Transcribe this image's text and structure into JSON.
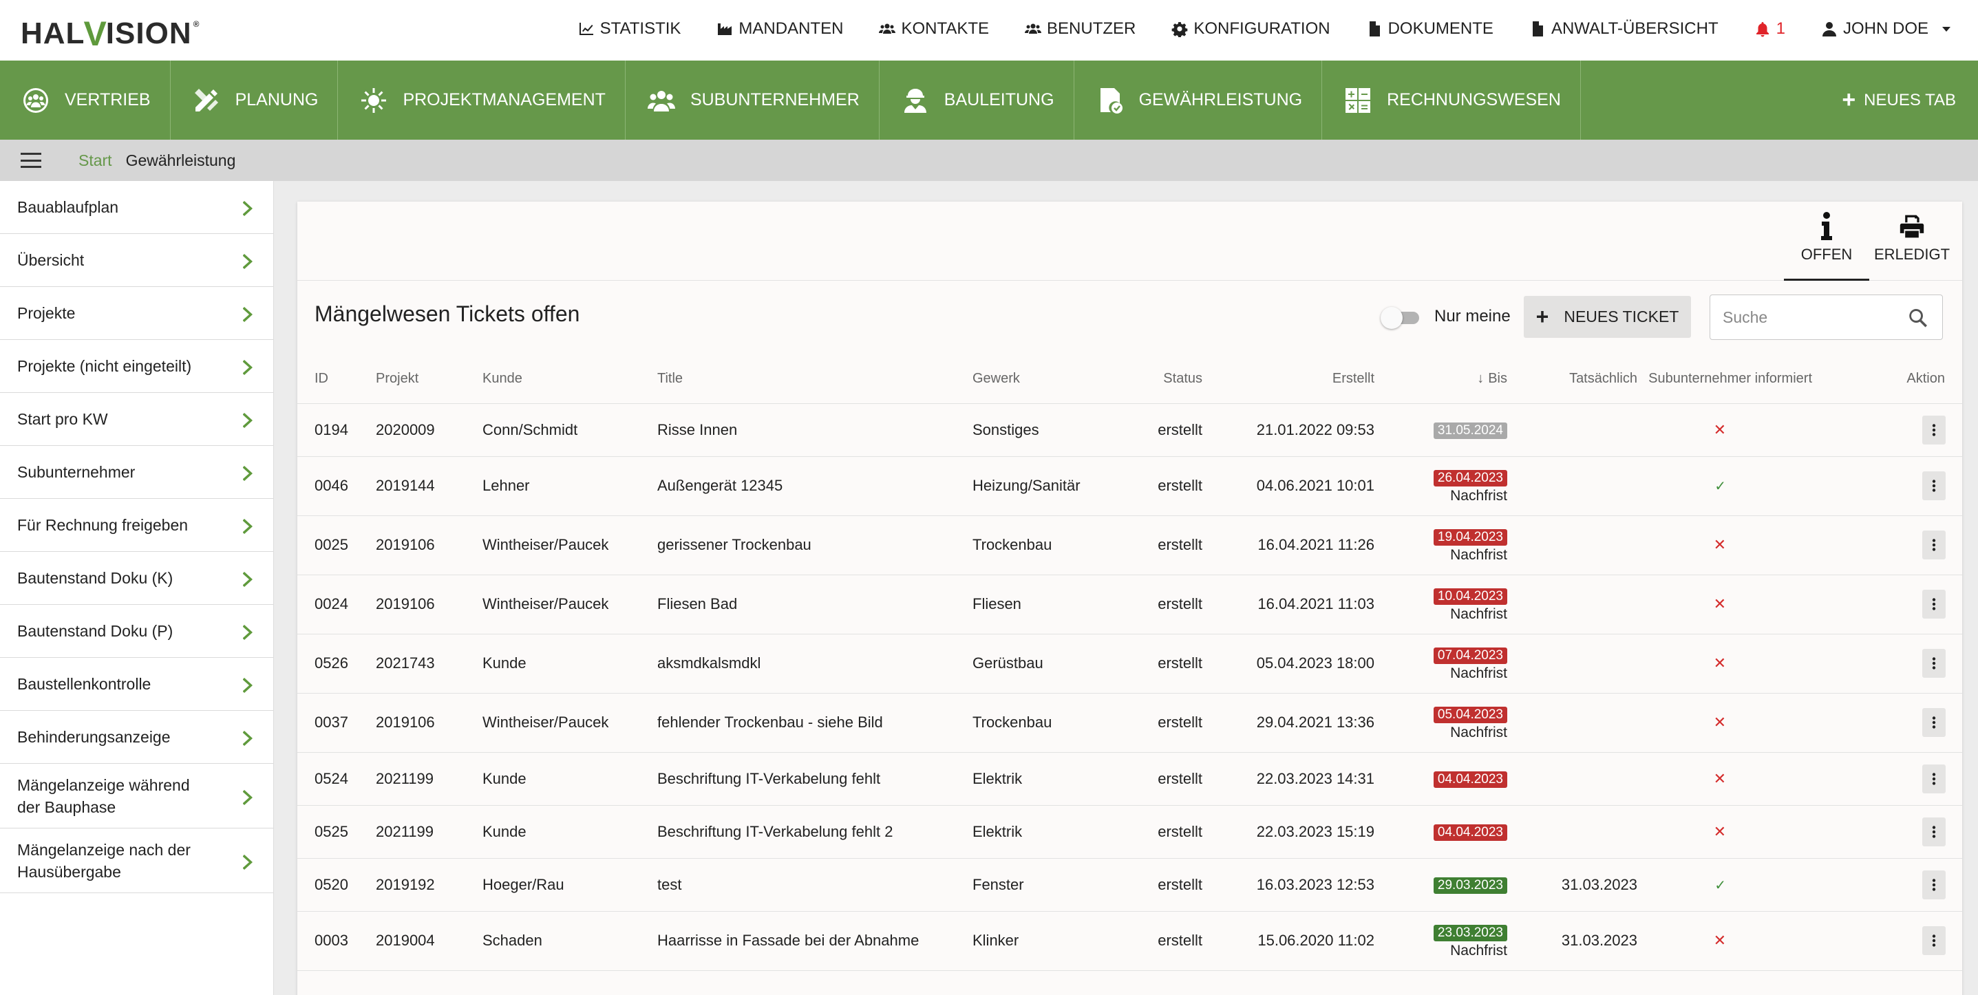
{
  "brand": {
    "logo_pre": "HAL",
    "logo_v": "V",
    "logo_post": "ISION",
    "logo_reg": "®"
  },
  "topnav": [
    {
      "label": "STATISTIK",
      "icon": "chart-line-icon"
    },
    {
      "label": "MANDANTEN",
      "icon": "industry-icon"
    },
    {
      "label": "KONTAKTE",
      "icon": "users-icon"
    },
    {
      "label": "BENUTZER",
      "icon": "users-icon"
    },
    {
      "label": "KONFIGURATION",
      "icon": "gear-icon"
    },
    {
      "label": "DOKUMENTE",
      "icon": "file-icon"
    },
    {
      "label": "ANWALT-ÜBERSICHT",
      "icon": "file-icon"
    }
  ],
  "notifications": {
    "count": "1",
    "icon": "bell-icon",
    "color": "#e0242a"
  },
  "user": {
    "name": "JOHN DOE",
    "icon": "user-icon"
  },
  "modules": [
    {
      "label": "VERTRIEB",
      "icon": "team-circle-icon"
    },
    {
      "label": "PLANUNG",
      "icon": "pencil-ruler-icon"
    },
    {
      "label": "PROJEKTMANAGEMENT",
      "icon": "sun-gear-icon"
    },
    {
      "label": "SUBUNTERNEHMER",
      "icon": "user-group-icon"
    },
    {
      "label": "BAULEITUNG",
      "icon": "hard-hat-worker-icon"
    },
    {
      "label": "GEWÄHRLEISTUNG",
      "icon": "document-check-icon"
    },
    {
      "label": "RECHNUNGSWESEN",
      "icon": "calculator-icon"
    }
  ],
  "new_tab_label": "NEUES TAB",
  "breadcrumb": {
    "start": "Start",
    "current": "Gewährleistung"
  },
  "sidebar": [
    "Bauablaufplan",
    "Übersicht",
    "Projekte",
    "Projekte (nicht eingeteilt)",
    "Start pro KW",
    "Subunternehmer",
    "Für Rechnung freigeben",
    "Bautenstand Doku (K)",
    "Bautenstand Doku (P)",
    "Baustellenkontrolle",
    "Behinderungsanzeige",
    "Mängelanzeige während der Bauphase",
    "Mängelanzeige nach der Hausübergabe"
  ],
  "view_tabs": [
    {
      "label": "OFFEN",
      "icon": "info-icon",
      "active": true
    },
    {
      "label": "ERLEDIGT",
      "icon": "printer-icon",
      "active": false
    }
  ],
  "page_title": "Mängelwesen Tickets offen",
  "toggle_label": "Nur meine",
  "new_ticket_label": "NEUES TICKET",
  "search": {
    "placeholder": "Suche",
    "value": ""
  },
  "columns": [
    "ID",
    "Projekt",
    "Kunde",
    "Title",
    "Gewerk",
    "Status",
    "Erstellt",
    "Bis",
    "Tatsächlich",
    "Subunternehmer informiert",
    "Aktion"
  ],
  "colors": {
    "accent": "#66984a",
    "badge_gray": "#a9a9a9",
    "badge_red": "#c0302f",
    "badge_green": "#3f7f32"
  },
  "rows": [
    {
      "id": "0194",
      "projekt": "2020009",
      "kunde": "Conn/Schmidt",
      "title": "Risse Innen",
      "gewerk": "Sonstiges",
      "status": "erstellt",
      "erstellt": "21.01.2022 09:53",
      "bis": "31.05.2024",
      "bis_color": "gray",
      "nachfrist": "",
      "tatsaechlich": "",
      "informiert": "✕"
    },
    {
      "id": "0046",
      "projekt": "2019144",
      "kunde": "Lehner",
      "title": "Außengerät 12345",
      "gewerk": "Heizung/Sanitär",
      "status": "erstellt",
      "erstellt": "04.06.2021 10:01",
      "bis": "26.04.2023",
      "bis_color": "red",
      "nachfrist": "Nachfrist",
      "tatsaechlich": "",
      "informiert": "✓"
    },
    {
      "id": "0025",
      "projekt": "2019106",
      "kunde": "Wintheiser/Paucek",
      "title": "gerissener Trockenbau",
      "gewerk": "Trockenbau",
      "status": "erstellt",
      "erstellt": "16.04.2021 11:26",
      "bis": "19.04.2023",
      "bis_color": "red",
      "nachfrist": "Nachfrist",
      "tatsaechlich": "",
      "informiert": "✕"
    },
    {
      "id": "0024",
      "projekt": "2019106",
      "kunde": "Wintheiser/Paucek",
      "title": "Fliesen Bad",
      "gewerk": "Fliesen",
      "status": "erstellt",
      "erstellt": "16.04.2021 11:03",
      "bis": "10.04.2023",
      "bis_color": "red",
      "nachfrist": "Nachfrist",
      "tatsaechlich": "",
      "informiert": "✕"
    },
    {
      "id": "0526",
      "projekt": "2021743",
      "kunde": "Kunde",
      "title": "aksmdkalsmdkl",
      "gewerk": "Gerüstbau",
      "status": "erstellt",
      "erstellt": "05.04.2023 18:00",
      "bis": "07.04.2023",
      "bis_color": "red",
      "nachfrist": "Nachfrist",
      "tatsaechlich": "",
      "informiert": "✕"
    },
    {
      "id": "0037",
      "projekt": "2019106",
      "kunde": "Wintheiser/Paucek",
      "title": "fehlender Trockenbau - siehe Bild",
      "gewerk": "Trockenbau",
      "status": "erstellt",
      "erstellt": "29.04.2021 13:36",
      "bis": "05.04.2023",
      "bis_color": "red",
      "nachfrist": "Nachfrist",
      "tatsaechlich": "",
      "informiert": "✕"
    },
    {
      "id": "0524",
      "projekt": "2021199",
      "kunde": "Kunde",
      "title": "Beschriftung IT-Verkabelung fehlt",
      "gewerk": "Elektrik",
      "status": "erstellt",
      "erstellt": "22.03.2023 14:31",
      "bis": "04.04.2023",
      "bis_color": "red",
      "nachfrist": "",
      "tatsaechlich": "",
      "informiert": "✕"
    },
    {
      "id": "0525",
      "projekt": "2021199",
      "kunde": "Kunde",
      "title": "Beschriftung IT-Verkabelung fehlt 2",
      "gewerk": "Elektrik",
      "status": "erstellt",
      "erstellt": "22.03.2023 15:19",
      "bis": "04.04.2023",
      "bis_color": "red",
      "nachfrist": "",
      "tatsaechlich": "",
      "informiert": "✕"
    },
    {
      "id": "0520",
      "projekt": "2019192",
      "kunde": "Hoeger/Rau",
      "title": "test",
      "gewerk": "Fenster",
      "status": "erstellt",
      "erstellt": "16.03.2023 12:53",
      "bis": "29.03.2023",
      "bis_color": "green",
      "nachfrist": "",
      "tatsaechlich": "31.03.2023",
      "informiert": "✓"
    },
    {
      "id": "0003",
      "projekt": "2019004",
      "kunde": "Schaden",
      "title": "Haarrisse in Fassade bei der Abnahme",
      "gewerk": "Klinker",
      "status": "erstellt",
      "erstellt": "15.06.2020 11:02",
      "bis": "23.03.2023",
      "bis_color": "green",
      "nachfrist": "Nachfrist",
      "tatsaechlich": "31.03.2023",
      "informiert": "✕"
    }
  ]
}
